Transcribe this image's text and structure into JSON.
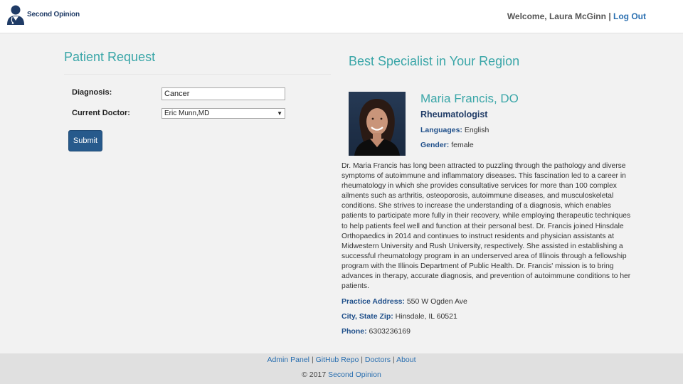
{
  "header": {
    "brand_name": "Second Opinion",
    "welcome_text": "Welcome, Laura McGinn",
    "separator": "|",
    "logout_label": "Log Out"
  },
  "patient_request": {
    "title": "Patient Request",
    "diagnosis_label": "Diagnosis:",
    "diagnosis_value": "Cancer",
    "current_doctor_label": "Current Doctor:",
    "current_doctor_value": "Eric Munn,MD",
    "submit_label": "Submit"
  },
  "specialist": {
    "title": "Best Specialist in Your Region",
    "name": "Maria Francis, DO",
    "specialty": "Rheumatologist",
    "languages_label": "Languages:",
    "languages_value": "English",
    "gender_label": "Gender:",
    "gender_value": "female",
    "bio": "Dr. Maria Francis has long been attracted to puzzling through the pathology and diverse symptoms of autoimmune and inflammatory diseases. This fascination led to a career in rheumatology in which she provides consultative services for more than 100 complex ailments such as arthritis, osteoporosis, autoimmune diseases, and musculoskeletal conditions. She strives to increase the understanding of a diagnosis, which enables patients to participate more fully in their recovery, while employing therapeutic techniques to help patients feel well and function at their personal best. Dr. Francis joined Hinsdale Orthopaedics in 2014 and continues to instruct residents and physician assistants at Midwestern University and Rush University, respectively. She assisted in establishing a successful rheumatology program in an underserved area of Illinois through a fellowship program with the Illinois Department of Public Health. Dr. Francis' mission is to bring advances in therapy, accurate diagnosis, and prevention of autoimmune conditions to her patients.",
    "address_label": "Practice Address:",
    "address_value": "550 W Ogden Ave",
    "city_label": "City, State Zip:",
    "city_value": "Hinsdale, IL 60521",
    "phone_label": "Phone:",
    "phone_value": "6303236169"
  },
  "footer": {
    "links": [
      "Admin Panel",
      "GitHub Repo",
      "Doctors",
      "About"
    ],
    "separator": "|",
    "copyright_prefix": "© 2017",
    "copyright_link": "Second Opinion"
  },
  "icons": {
    "logo": "doctor-avatar-icon",
    "dropdown": "triangle-down-icon"
  },
  "colors": {
    "accent_teal": "#3aa6a8",
    "navy": "#1f3b66",
    "link_blue": "#2a6fb0",
    "button_blue": "#275a8c",
    "page_bg": "#f2f2f2",
    "footer_bg": "#e0e0e0"
  }
}
